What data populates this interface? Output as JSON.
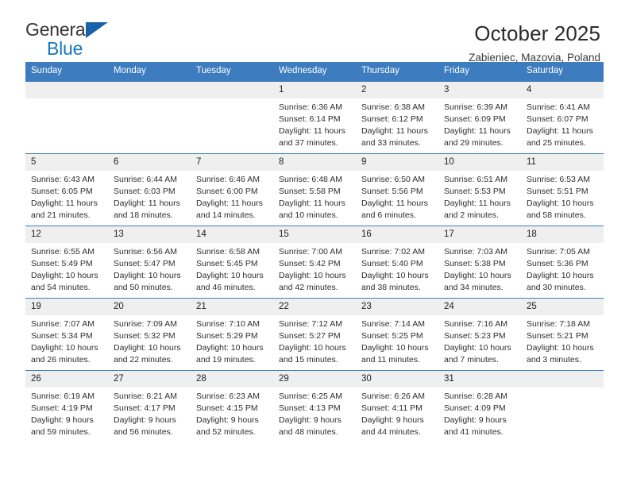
{
  "brand": {
    "name_part1": "General",
    "name_part2": "Blue",
    "triangle_color": "#1862ab",
    "blue_color": "#1675c0"
  },
  "header": {
    "title": "October 2025",
    "subtitle": "Zabieniec, Mazovia, Poland"
  },
  "theme": {
    "header_row_bg": "#3c7cbf",
    "day_number_bg": "#efefef",
    "text_color": "#222222"
  },
  "calendar": {
    "weekdays": [
      "Sunday",
      "Monday",
      "Tuesday",
      "Wednesday",
      "Thursday",
      "Friday",
      "Saturday"
    ],
    "weeks": [
      [
        {
          "day": "",
          "lines": []
        },
        {
          "day": "",
          "lines": []
        },
        {
          "day": "",
          "lines": []
        },
        {
          "day": "1",
          "lines": [
            "Sunrise: 6:36 AM",
            "Sunset: 6:14 PM",
            "Daylight: 11 hours",
            "and 37 minutes."
          ]
        },
        {
          "day": "2",
          "lines": [
            "Sunrise: 6:38 AM",
            "Sunset: 6:12 PM",
            "Daylight: 11 hours",
            "and 33 minutes."
          ]
        },
        {
          "day": "3",
          "lines": [
            "Sunrise: 6:39 AM",
            "Sunset: 6:09 PM",
            "Daylight: 11 hours",
            "and 29 minutes."
          ]
        },
        {
          "day": "4",
          "lines": [
            "Sunrise: 6:41 AM",
            "Sunset: 6:07 PM",
            "Daylight: 11 hours",
            "and 25 minutes."
          ]
        }
      ],
      [
        {
          "day": "5",
          "lines": [
            "Sunrise: 6:43 AM",
            "Sunset: 6:05 PM",
            "Daylight: 11 hours",
            "and 21 minutes."
          ]
        },
        {
          "day": "6",
          "lines": [
            "Sunrise: 6:44 AM",
            "Sunset: 6:03 PM",
            "Daylight: 11 hours",
            "and 18 minutes."
          ]
        },
        {
          "day": "7",
          "lines": [
            "Sunrise: 6:46 AM",
            "Sunset: 6:00 PM",
            "Daylight: 11 hours",
            "and 14 minutes."
          ]
        },
        {
          "day": "8",
          "lines": [
            "Sunrise: 6:48 AM",
            "Sunset: 5:58 PM",
            "Daylight: 11 hours",
            "and 10 minutes."
          ]
        },
        {
          "day": "9",
          "lines": [
            "Sunrise: 6:50 AM",
            "Sunset: 5:56 PM",
            "Daylight: 11 hours",
            "and 6 minutes."
          ]
        },
        {
          "day": "10",
          "lines": [
            "Sunrise: 6:51 AM",
            "Sunset: 5:53 PM",
            "Daylight: 11 hours",
            "and 2 minutes."
          ]
        },
        {
          "day": "11",
          "lines": [
            "Sunrise: 6:53 AM",
            "Sunset: 5:51 PM",
            "Daylight: 10 hours",
            "and 58 minutes."
          ]
        }
      ],
      [
        {
          "day": "12",
          "lines": [
            "Sunrise: 6:55 AM",
            "Sunset: 5:49 PM",
            "Daylight: 10 hours",
            "and 54 minutes."
          ]
        },
        {
          "day": "13",
          "lines": [
            "Sunrise: 6:56 AM",
            "Sunset: 5:47 PM",
            "Daylight: 10 hours",
            "and 50 minutes."
          ]
        },
        {
          "day": "14",
          "lines": [
            "Sunrise: 6:58 AM",
            "Sunset: 5:45 PM",
            "Daylight: 10 hours",
            "and 46 minutes."
          ]
        },
        {
          "day": "15",
          "lines": [
            "Sunrise: 7:00 AM",
            "Sunset: 5:42 PM",
            "Daylight: 10 hours",
            "and 42 minutes."
          ]
        },
        {
          "day": "16",
          "lines": [
            "Sunrise: 7:02 AM",
            "Sunset: 5:40 PM",
            "Daylight: 10 hours",
            "and 38 minutes."
          ]
        },
        {
          "day": "17",
          "lines": [
            "Sunrise: 7:03 AM",
            "Sunset: 5:38 PM",
            "Daylight: 10 hours",
            "and 34 minutes."
          ]
        },
        {
          "day": "18",
          "lines": [
            "Sunrise: 7:05 AM",
            "Sunset: 5:36 PM",
            "Daylight: 10 hours",
            "and 30 minutes."
          ]
        }
      ],
      [
        {
          "day": "19",
          "lines": [
            "Sunrise: 7:07 AM",
            "Sunset: 5:34 PM",
            "Daylight: 10 hours",
            "and 26 minutes."
          ]
        },
        {
          "day": "20",
          "lines": [
            "Sunrise: 7:09 AM",
            "Sunset: 5:32 PM",
            "Daylight: 10 hours",
            "and 22 minutes."
          ]
        },
        {
          "day": "21",
          "lines": [
            "Sunrise: 7:10 AM",
            "Sunset: 5:29 PM",
            "Daylight: 10 hours",
            "and 19 minutes."
          ]
        },
        {
          "day": "22",
          "lines": [
            "Sunrise: 7:12 AM",
            "Sunset: 5:27 PM",
            "Daylight: 10 hours",
            "and 15 minutes."
          ]
        },
        {
          "day": "23",
          "lines": [
            "Sunrise: 7:14 AM",
            "Sunset: 5:25 PM",
            "Daylight: 10 hours",
            "and 11 minutes."
          ]
        },
        {
          "day": "24",
          "lines": [
            "Sunrise: 7:16 AM",
            "Sunset: 5:23 PM",
            "Daylight: 10 hours",
            "and 7 minutes."
          ]
        },
        {
          "day": "25",
          "lines": [
            "Sunrise: 7:18 AM",
            "Sunset: 5:21 PM",
            "Daylight: 10 hours",
            "and 3 minutes."
          ]
        }
      ],
      [
        {
          "day": "26",
          "lines": [
            "Sunrise: 6:19 AM",
            "Sunset: 4:19 PM",
            "Daylight: 9 hours",
            "and 59 minutes."
          ]
        },
        {
          "day": "27",
          "lines": [
            "Sunrise: 6:21 AM",
            "Sunset: 4:17 PM",
            "Daylight: 9 hours",
            "and 56 minutes."
          ]
        },
        {
          "day": "28",
          "lines": [
            "Sunrise: 6:23 AM",
            "Sunset: 4:15 PM",
            "Daylight: 9 hours",
            "and 52 minutes."
          ]
        },
        {
          "day": "29",
          "lines": [
            "Sunrise: 6:25 AM",
            "Sunset: 4:13 PM",
            "Daylight: 9 hours",
            "and 48 minutes."
          ]
        },
        {
          "day": "30",
          "lines": [
            "Sunrise: 6:26 AM",
            "Sunset: 4:11 PM",
            "Daylight: 9 hours",
            "and 44 minutes."
          ]
        },
        {
          "day": "31",
          "lines": [
            "Sunrise: 6:28 AM",
            "Sunset: 4:09 PM",
            "Daylight: 9 hours",
            "and 41 minutes."
          ]
        },
        {
          "day": "",
          "lines": []
        }
      ]
    ]
  }
}
